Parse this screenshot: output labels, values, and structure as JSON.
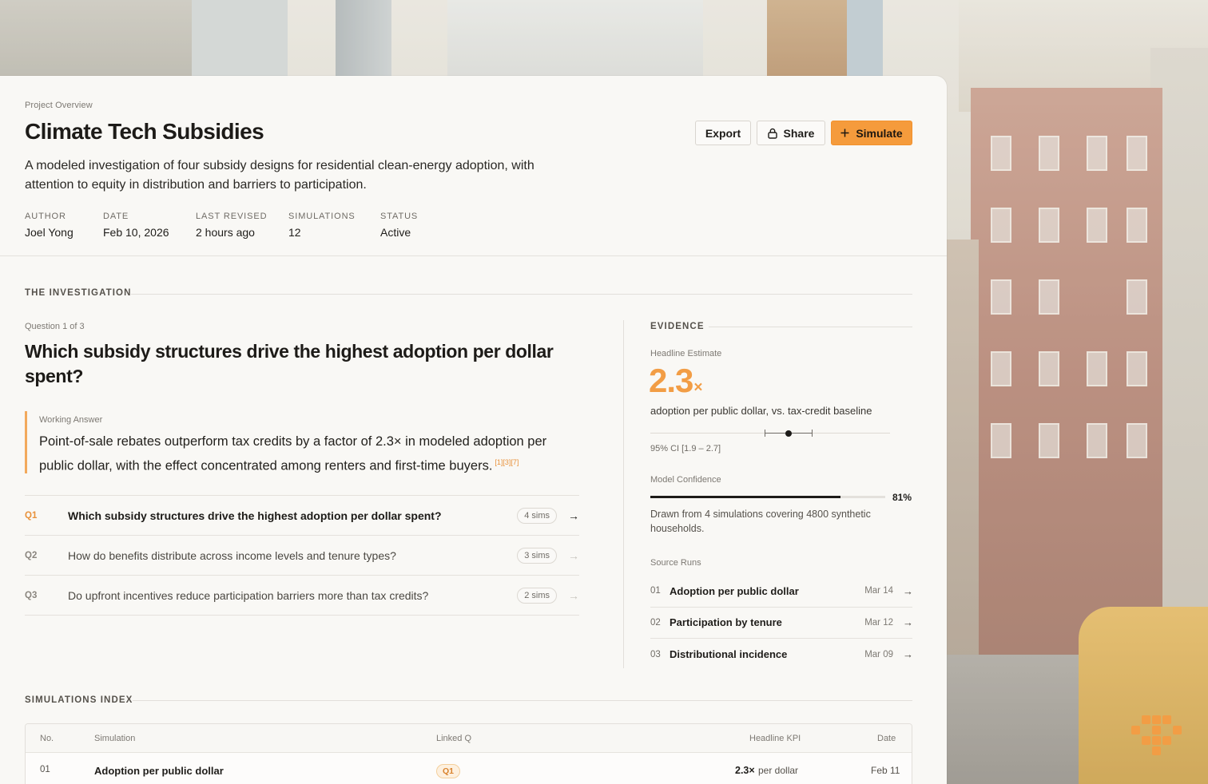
{
  "header": {
    "eyebrow": "Project Overview",
    "title": "Climate Tech Subsidies",
    "description": "A modeled investigation of four subsidy designs for residential clean-energy adoption, with attention to equity in distribution and barriers to participation.",
    "actions": {
      "export": "Export",
      "share": "Share",
      "simulate": "Simulate"
    },
    "meta": [
      {
        "key": "AUTHOR",
        "value": "Joel Yong"
      },
      {
        "key": "DATE",
        "value": "Feb 10, 2026"
      },
      {
        "key": "LAST REVISED",
        "value": "2 hours ago"
      },
      {
        "key": "SIMULATIONS",
        "value": "12"
      },
      {
        "key": "STATUS",
        "value": "Active"
      }
    ]
  },
  "investigation": {
    "section_label": "THE INVESTIGATION",
    "question_count": "Question 1 of 3",
    "question": "Which subsidy structures drive the highest adoption per dollar spent?",
    "working_answer_label": "Working Answer",
    "working_answer": "Point-of-sale rebates outperform tax credits by a factor of 2.3× in modeled adoption per public dollar, with the effect concentrated among renters and first-time buyers.",
    "citations": "[1][3][7]",
    "questions": [
      {
        "id": "Q1",
        "text": "Which subsidy structures drive the highest adoption per dollar spent?",
        "sims": "4 sims",
        "active": true
      },
      {
        "id": "Q2",
        "text": "How do benefits distribute across income levels and tenure types?",
        "sims": "3 sims",
        "active": false
      },
      {
        "id": "Q3",
        "text": "Do upfront incentives reduce participation barriers more than tax credits?",
        "sims": "2 sims",
        "active": false
      }
    ]
  },
  "evidence": {
    "section_label": "EVIDENCE",
    "headline_label": "Headline Estimate",
    "headline_value": "2.3",
    "headline_unit": "×",
    "headline_sub": "adoption per public dollar, vs. tax-credit baseline",
    "ci_text": "95% CI [1.9 – 2.7]",
    "confidence_label": "Model Confidence",
    "confidence_value": "81%",
    "confidence_fraction": 0.81,
    "confidence_note": "Drawn from 4 simulations covering 4800 synthetic households.",
    "source_runs_label": "Source Runs",
    "source_runs": [
      {
        "n": "01",
        "title": "Adoption per public dollar",
        "date": "Mar 14"
      },
      {
        "n": "02",
        "title": "Participation by tenure",
        "date": "Mar 12"
      },
      {
        "n": "03",
        "title": "Distributional incidence",
        "date": "Mar 09"
      }
    ]
  },
  "simulations_index": {
    "section_label": "SIMULATIONS INDEX",
    "columns": {
      "no": "No.",
      "simulation": "Simulation",
      "linked_q": "Linked Q",
      "kpi": "Headline KPI",
      "date": "Date"
    },
    "rows": [
      {
        "no": "01",
        "simulation": "Adoption per public dollar",
        "linked_q": "Q1",
        "kpi_value": "2.3×",
        "kpi_unit": "per dollar",
        "date": "Feb 11"
      }
    ]
  },
  "icons": {
    "lock": "lock-icon",
    "plus": "plus-icon",
    "arrow": "arrow-right-icon",
    "logo": "brand-logo"
  },
  "colors": {
    "accent": "#f59b3c",
    "accent_text": "#e8913a",
    "ink": "#1d1b18"
  }
}
